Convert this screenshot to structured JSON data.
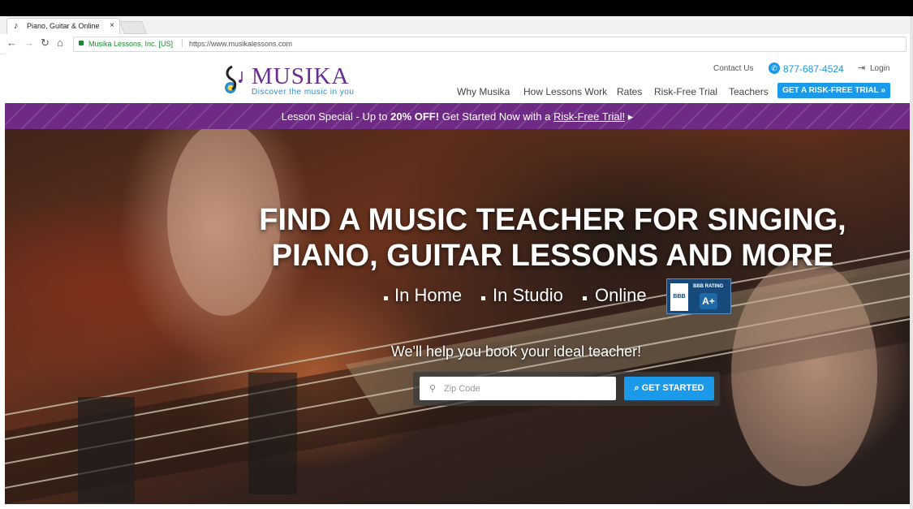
{
  "browser": {
    "tab_title": "Piano, Guitar & Online M",
    "tab_close": "×",
    "organization": "Musika Lessons, Inc. [US]",
    "url": "https://www.musikalessons.com",
    "nav_icons": [
      "back-icon",
      "forward-icon",
      "reload-icon",
      "home-icon"
    ]
  },
  "header": {
    "logo_name": "MUSIKA",
    "logo_tagline": "Discover the music in you",
    "contact_us": "Contact Us",
    "phone": "877-687-4524",
    "login": "Login",
    "nav": [
      "Why Musika",
      "How Lessons Work",
      "Rates",
      "Risk-Free Trial",
      "Teachers"
    ],
    "cta": "GET A RISK-FREE TRIAL »"
  },
  "promo": {
    "prefix": "Lesson Special - Up to ",
    "discount": "20% OFF!",
    "middle": " Get Started Now with a ",
    "link": "Risk-Free Trial!",
    "arrow": " ▸"
  },
  "hero": {
    "headline_line1": "FIND A MUSIC TEACHER FOR SINGING,",
    "headline_line2": "PIANO, GUITAR LESSONS AND MORE",
    "options": [
      "In Home",
      "In Studio",
      "Online"
    ],
    "bbb_label": "BBB",
    "bbb_rating_label": "BBB RATING",
    "bbb_grade": "A+",
    "subheading": "We'll help you book your ideal teacher!",
    "zip_placeholder": "Zip Code",
    "button_label": "GET STARTED"
  },
  "colors": {
    "brand_purple": "#6e2a84",
    "accent_blue": "#1a9ae8"
  }
}
